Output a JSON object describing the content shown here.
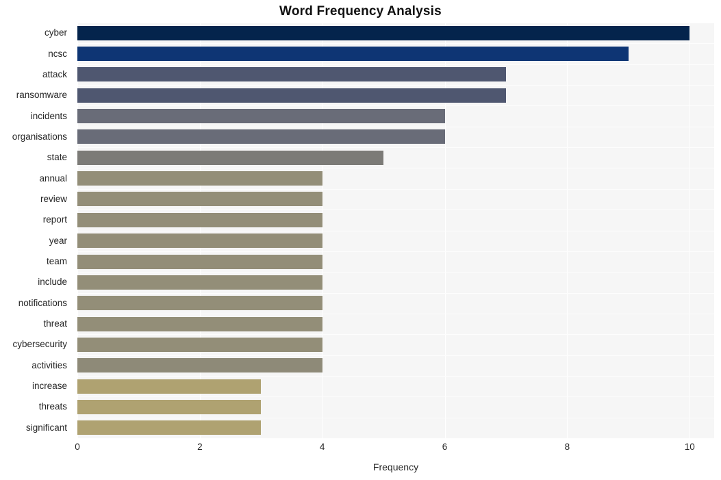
{
  "chart_data": {
    "type": "bar",
    "orientation": "horizontal",
    "title": "Word Frequency Analysis",
    "xlabel": "Frequency",
    "ylabel": "",
    "xlim": [
      0,
      10.4
    ],
    "ylim": [
      0,
      20
    ],
    "grid": true,
    "legend": false,
    "categories": [
      "cyber",
      "ncsc",
      "attack",
      "ransomware",
      "incidents",
      "organisations",
      "state",
      "annual",
      "review",
      "report",
      "year",
      "team",
      "include",
      "notifications",
      "threat",
      "cybersecurity",
      "activities",
      "increase",
      "threats",
      "significant"
    ],
    "values": [
      10,
      9,
      7,
      7,
      6,
      6,
      5,
      4,
      4,
      4,
      4,
      4,
      4,
      4,
      4,
      4,
      4,
      3,
      3,
      3
    ],
    "bar_colors": [
      "#04244c",
      "#0e3574",
      "#4f5770",
      "#4f5770",
      "#696c78",
      "#696c78",
      "#7c7b77",
      "#938e78",
      "#938e78",
      "#938e78",
      "#938e78",
      "#938e78",
      "#938e78",
      "#938e78",
      "#938e78",
      "#938e78",
      "#8e8a78",
      "#afa271",
      "#afa271",
      "#afa271"
    ],
    "x_ticks": [
      0,
      2,
      4,
      6,
      8,
      10
    ],
    "x_tick_labels": [
      "0",
      "2",
      "4",
      "6",
      "8",
      "10"
    ],
    "plot_background": "#f6f6f6",
    "gridline_color": "#ffffff",
    "figure_background": "#ffffff",
    "title_color": "#111111",
    "tick_label_color": "#262626"
  }
}
